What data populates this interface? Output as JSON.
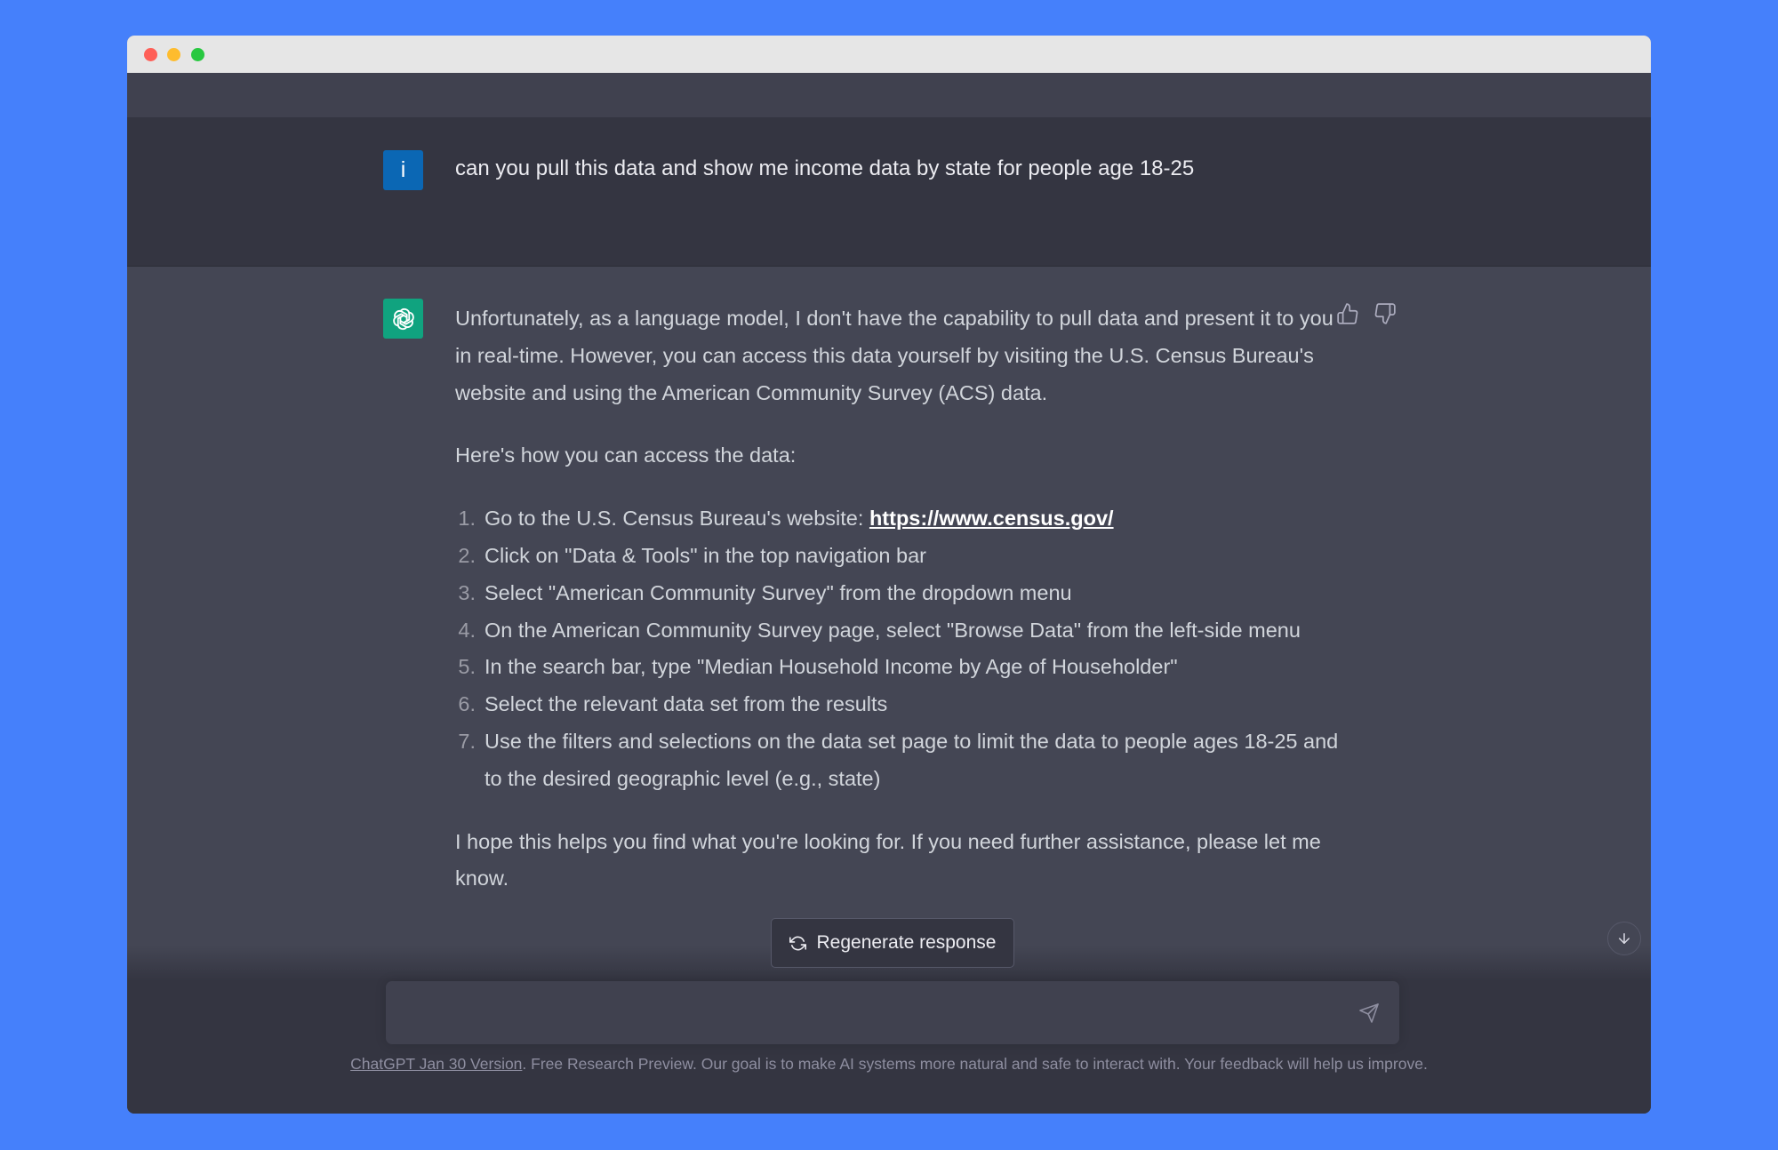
{
  "window": {
    "controls": [
      "close",
      "minimize",
      "zoom"
    ]
  },
  "user_message": {
    "avatar_letter": "i",
    "text": "can you pull this data and show me income data by state for people age 18-25"
  },
  "assistant_message": {
    "avatar_icon": "openai-logo-icon",
    "intro": "Unfortunately, as a language model, I don't have the capability to pull data and present it to you in real-time. However, you can access this data yourself by visiting the U.S. Census Bureau's website and using the American Community Survey (ACS) data.",
    "howto": "Here's how you can access the data:",
    "steps": [
      {
        "num": "1.",
        "text": "Go to the U.S. Census Bureau's website: ",
        "link": "https://www.census.gov/"
      },
      {
        "num": "2.",
        "text": "Click on \"Data & Tools\" in the top navigation bar"
      },
      {
        "num": "3.",
        "text": "Select \"American Community Survey\" from the dropdown menu"
      },
      {
        "num": "4.",
        "text": "On the American Community Survey page, select \"Browse Data\" from the left-side menu"
      },
      {
        "num": "5.",
        "text": "In the search bar, type \"Median Household Income by Age of Householder\""
      },
      {
        "num": "6.",
        "text": "Select the relevant data set from the results"
      },
      {
        "num": "7.",
        "text": "Use the filters and selections on the data set page to limit the data to people ages 18-25 and to the desired geographic level (e.g., state)"
      }
    ],
    "closing": "I hope this helps you find what you're looking for. If you need further assistance, please let me know.",
    "feedback_icons": [
      "thumbs-up-icon",
      "thumbs-down-icon"
    ]
  },
  "regenerate": {
    "label": "Regenerate response"
  },
  "input": {
    "placeholder": "",
    "value": ""
  },
  "footer": {
    "version_link": "ChatGPT Jan 30 Version",
    "text": ". Free Research Preview. Our goal is to make AI systems more natural and safe to interact with. Your feedback will help us improve."
  },
  "colors": {
    "background": "#4580fb",
    "user_row": "#343541",
    "assistant_row": "#444654",
    "gpt_accent": "#10a37f",
    "user_avatar": "#0b67b4"
  }
}
